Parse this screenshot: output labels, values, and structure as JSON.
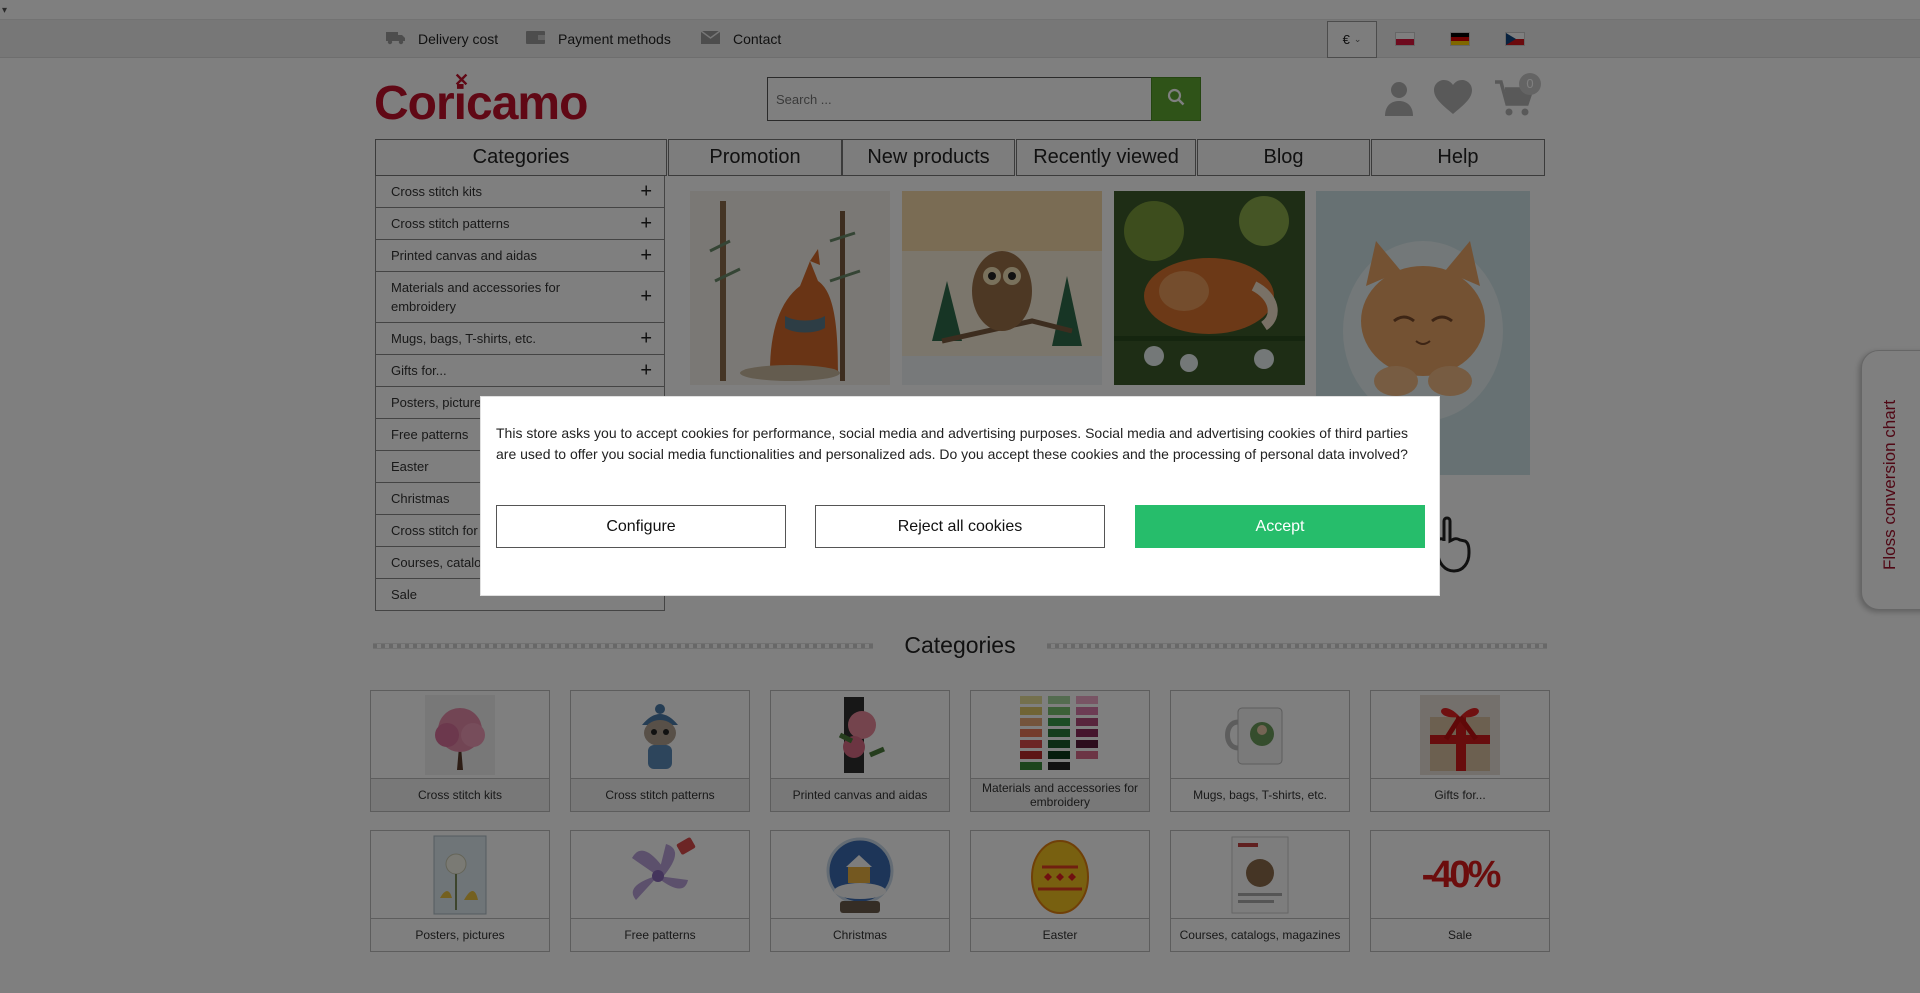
{
  "topbar": {
    "links": [
      {
        "label": "Delivery cost",
        "icon": "truck-icon"
      },
      {
        "label": "Payment methods",
        "icon": "wallet-icon"
      },
      {
        "label": "Contact",
        "icon": "envelope-icon"
      }
    ],
    "currency": "€",
    "languages": [
      "pl-flag-icon",
      "de-flag-icon",
      "cz-flag-icon"
    ]
  },
  "header": {
    "logo": "Coricamo",
    "search_placeholder": "Search ...",
    "cart_count": "0"
  },
  "nav": {
    "tabs": [
      "Categories",
      "Promotion",
      "New products",
      "Recently viewed",
      "Blog",
      "Help"
    ]
  },
  "sidebar": {
    "items": [
      {
        "label": "Cross stitch kits",
        "expand": "+"
      },
      {
        "label": "Cross stitch patterns",
        "expand": "+"
      },
      {
        "label": "Printed canvas and aidas",
        "expand": "+"
      },
      {
        "label": "Materials and accessories for embroidery",
        "expand": "+"
      },
      {
        "label": "Mugs, bags, T-shirts, etc.",
        "expand": "+"
      },
      {
        "label": "Gifts for...",
        "expand": "+"
      },
      {
        "label": "Posters, pictures",
        "expand": "+"
      },
      {
        "label": "Free patterns",
        "expand": ""
      },
      {
        "label": "Easter",
        "expand": ""
      },
      {
        "label": "Christmas",
        "expand": ""
      },
      {
        "label": "Cross stitch for",
        "expand": ""
      },
      {
        "label": "Courses, catalogs",
        "expand": ""
      },
      {
        "label": "Sale",
        "expand": ""
      }
    ]
  },
  "categories": {
    "heading": "Categories",
    "tiles": [
      {
        "label": "Cross stitch kits",
        "icon": "blossom-tree-icon"
      },
      {
        "label": "Cross stitch patterns",
        "icon": "cat-in-hat-icon"
      },
      {
        "label": "Printed canvas and aidas",
        "icon": "rose-icon"
      },
      {
        "label": "Materials and accessories for embroidery",
        "icon": "floss-palette-icon"
      },
      {
        "label": "Mugs, bags, T-shirts, etc.",
        "icon": "mug-icon"
      },
      {
        "label": "Gifts for...",
        "icon": "gift-icon"
      },
      {
        "label": "Posters, pictures",
        "icon": "poster-icon"
      },
      {
        "label": "Free patterns",
        "icon": "flower-icon"
      },
      {
        "label": "Christmas",
        "icon": "snow-globe-icon"
      },
      {
        "label": "Easter",
        "icon": "easter-egg-icon"
      },
      {
        "label": "Courses, catalogs, magazines",
        "icon": "magazine-icon"
      },
      {
        "label": "Sale",
        "icon": "discount-icon",
        "badge": "-40%"
      }
    ]
  },
  "side_tab": {
    "label": "Floss conversion chart"
  },
  "cookie_modal": {
    "text": "This store asks you to accept cookies for performance, social media and advertising purposes. Social media and advertising cookies of third parties are used to offer you social media functionalities and personalized ads. Do you accept these cookies and the processing of personal data involved?",
    "configure": "Configure",
    "reject": "Reject all cookies",
    "accept": "Accept"
  },
  "colors": {
    "brand": "#c0102a",
    "search_button": "#5fa731",
    "accept_button": "#26bd6b"
  }
}
